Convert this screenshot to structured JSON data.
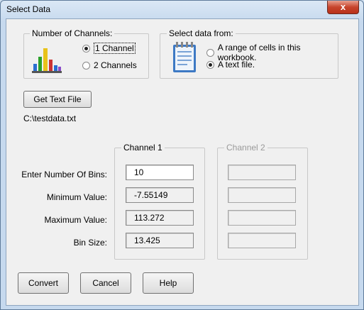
{
  "window": {
    "title": "Select Data",
    "close_glyph": "x"
  },
  "channels_group": {
    "label": "Number of Channels:",
    "options": [
      "1 Channel",
      "2 Channels"
    ],
    "selected": 0,
    "icon": "bar-chart-icon"
  },
  "source_group": {
    "label": "Select data from:",
    "options": [
      "A range of cells in this workbook.",
      "A text file."
    ],
    "selected": 1,
    "icon": "notepad-icon"
  },
  "get_text_file": {
    "label": "Get Text File"
  },
  "file_path": "C:\\testdata.txt",
  "channel1": {
    "label": "Channel 1",
    "bins": "10",
    "min": "-7.55149",
    "max": "113.272",
    "bin_size": "13.425"
  },
  "channel2": {
    "label": "Channel 2"
  },
  "row_labels": {
    "bins": "Enter Number Of Bins:",
    "min": "Minimum Value:",
    "max": "Maximum Value:",
    "bin_size": "Bin Size:"
  },
  "buttons": {
    "convert": "Convert",
    "cancel": "Cancel",
    "help": "Help"
  }
}
